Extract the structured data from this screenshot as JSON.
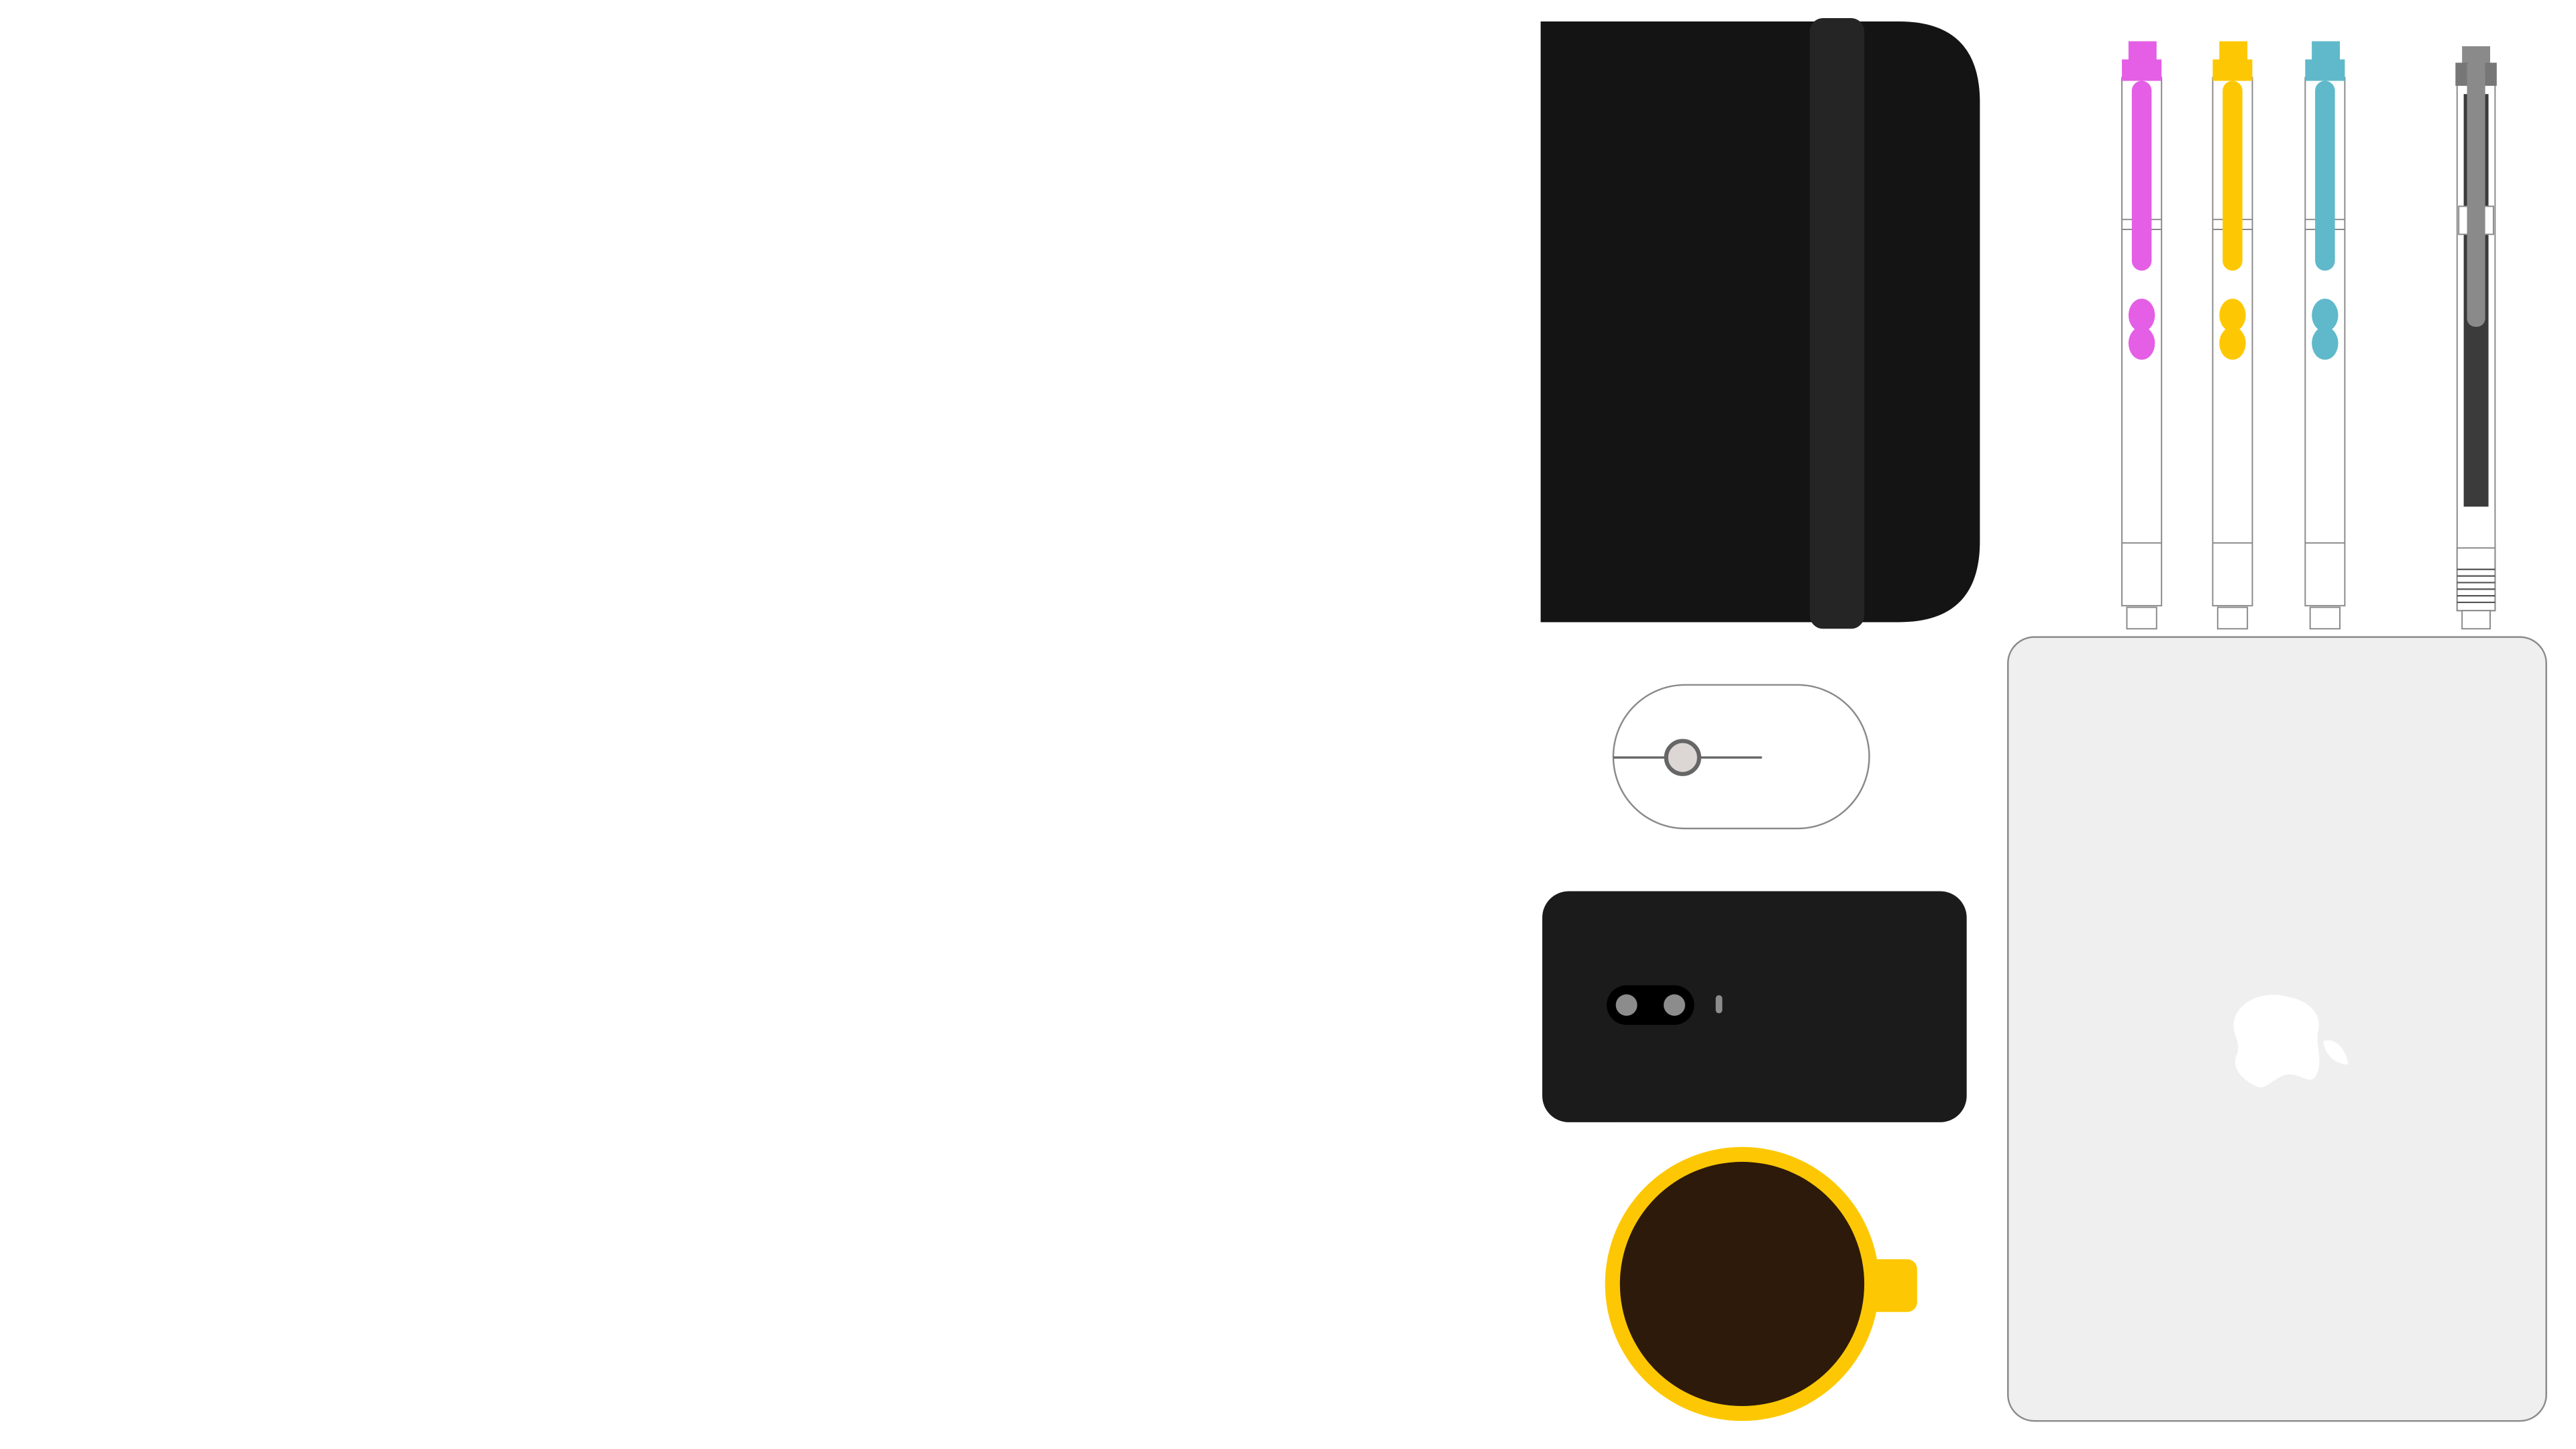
{
  "scene": {
    "background_color": "#ffffff",
    "objects": [
      "notebook-illustration",
      "highlighter-pen-magenta",
      "highlighter-pen-yellow",
      "highlighter-pen-teal",
      "mechanical-pencil-gray",
      "wireless-mouse-illustration",
      "smartphone-back-illustration",
      "coffee-mug-illustration",
      "laptop-lid-illustration",
      "apple-logo-icon"
    ]
  },
  "colors": {
    "notebook_cover": "#151415",
    "notebook_strap": "#262526",
    "pen_magenta": "#e45fe5",
    "pen_yellow": "#fdc803",
    "pen_teal": "#5fb9ca",
    "pencil_gray": "#8a8a8a",
    "pencil_dark": "#3b3b3b",
    "phone_body": "#1b1b1b",
    "phone_camera": "#000000",
    "phone_lens": "#8c8c8c",
    "mug_rim": "#fdc803",
    "mug_coffee": "#2e1a0a",
    "laptop_lid": "#efefef",
    "outline": "#8a8a8a"
  }
}
